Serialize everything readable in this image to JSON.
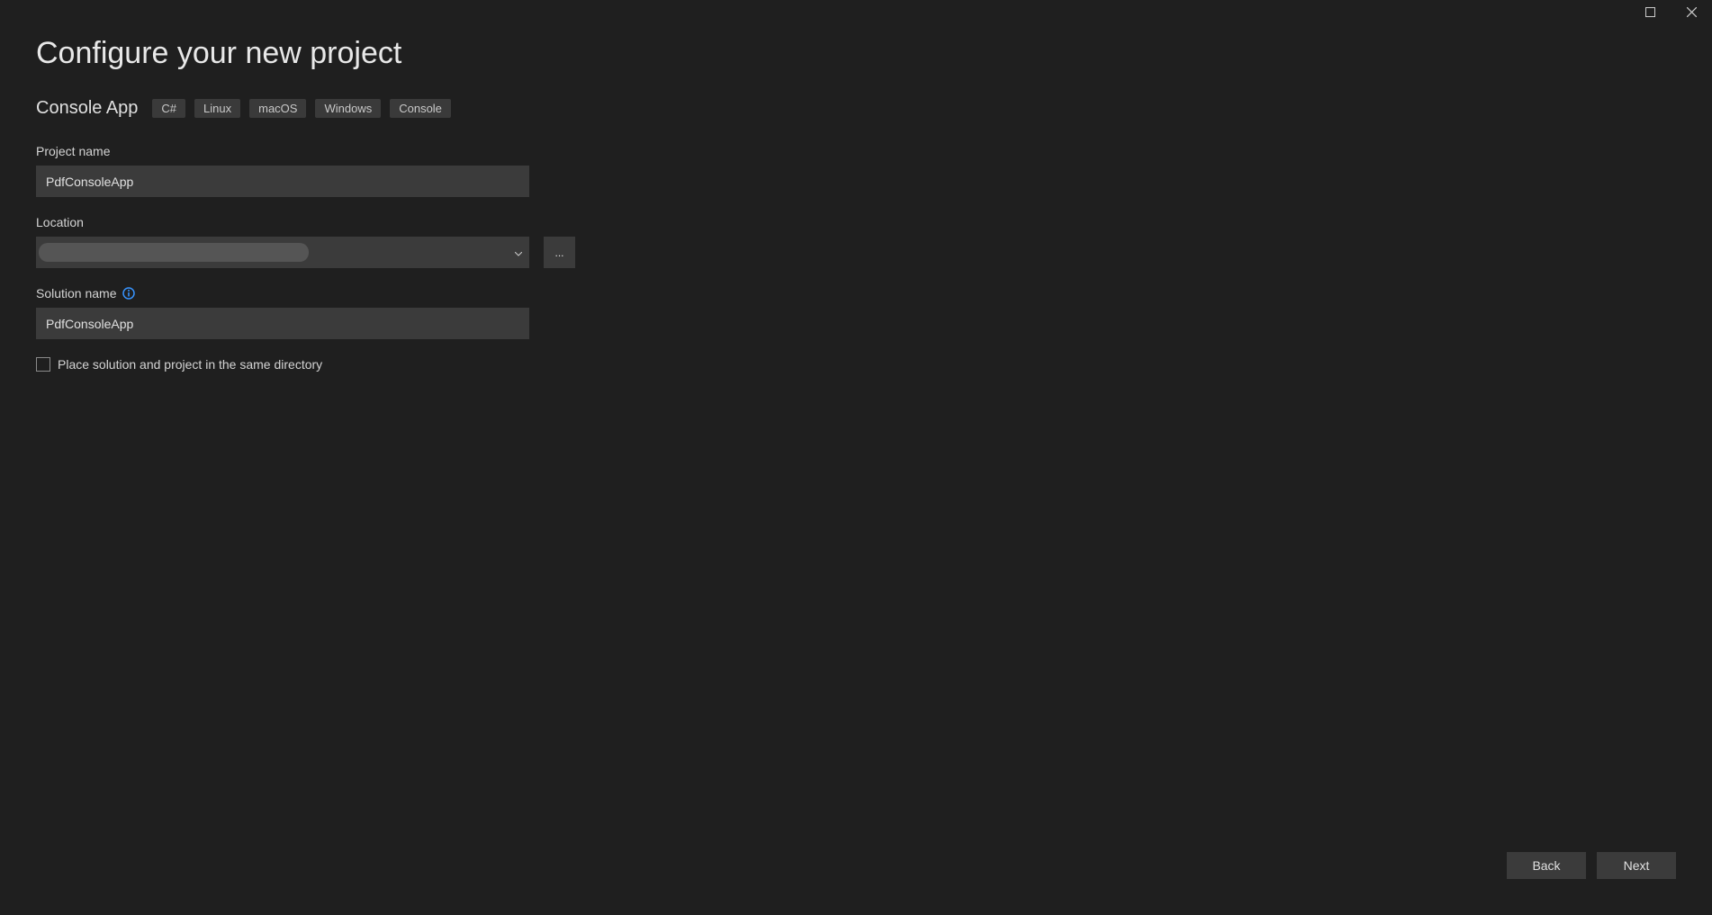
{
  "window": {
    "maximize_tooltip": "Maximize",
    "close_tooltip": "Close"
  },
  "header": {
    "title": "Configure your new project",
    "template_name": "Console App",
    "tags": [
      "C#",
      "Linux",
      "macOS",
      "Windows",
      "Console"
    ]
  },
  "form": {
    "project_name": {
      "label": "Project name",
      "value": "PdfConsoleApp"
    },
    "location": {
      "label": "Location",
      "value": "",
      "browse_label": "..."
    },
    "solution_name": {
      "label": "Solution name",
      "info_tooltip": "Info",
      "value": "PdfConsoleApp"
    },
    "same_directory": {
      "label": "Place solution and project in the same directory",
      "checked": false
    }
  },
  "footer": {
    "back_label": "Back",
    "next_label": "Next"
  }
}
